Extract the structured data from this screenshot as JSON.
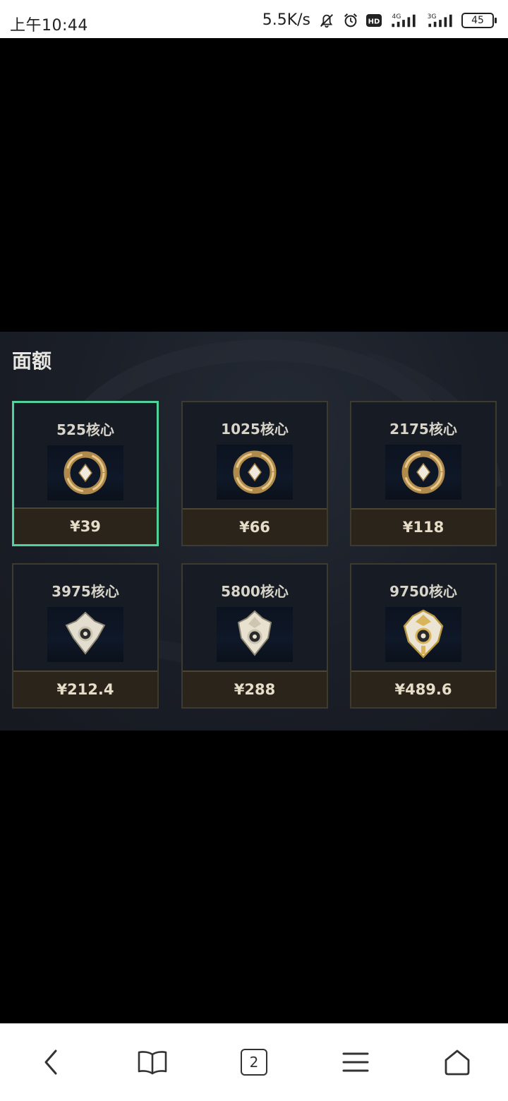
{
  "status_bar": {
    "time": "上午10:44",
    "net_speed": "5.5K/s",
    "signal1_label": "4G",
    "signal2_label": "3G",
    "hd_label": "HD",
    "battery": "45"
  },
  "panel": {
    "title": "面额",
    "cards": [
      {
        "amount": "525核心",
        "price": "¥39",
        "selected": true,
        "icon": "gold-ring-core-icon"
      },
      {
        "amount": "1025核心",
        "price": "¥66",
        "selected": false,
        "icon": "gold-ring-core-icon"
      },
      {
        "amount": "2175核心",
        "price": "¥118",
        "selected": false,
        "icon": "gold-ring-core-icon"
      },
      {
        "amount": "3975核心",
        "price": "¥212.4",
        "selected": false,
        "icon": "silver-crest-core-icon"
      },
      {
        "amount": "5800核心",
        "price": "¥288",
        "selected": false,
        "icon": "silver-crest-core-icon"
      },
      {
        "amount": "9750核心",
        "price": "¥489.6",
        "selected": false,
        "icon": "gold-silver-crest-core-icon"
      }
    ]
  },
  "nav_bar": {
    "tab_count": "2",
    "buttons": [
      "back-icon",
      "bookmarks-icon",
      "tabs-icon",
      "menu-icon",
      "home-icon"
    ]
  },
  "colors": {
    "selected_border": "#4fd39a",
    "price_bar": "#2a241b",
    "panel_bg": "#1a1e27"
  }
}
